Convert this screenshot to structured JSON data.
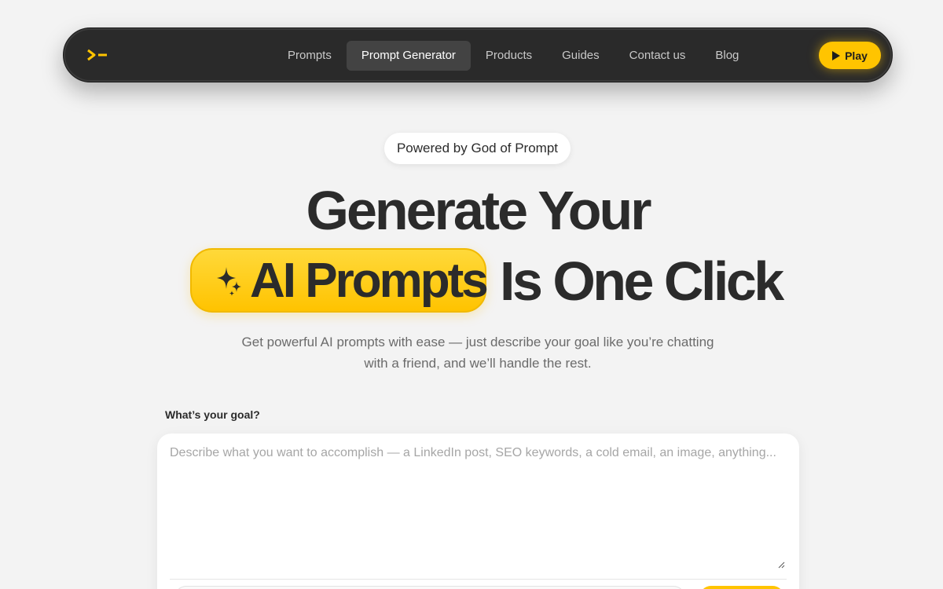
{
  "nav": {
    "links": [
      "Prompts",
      "Prompt Generator",
      "Products",
      "Guides",
      "Contact us",
      "Blog"
    ],
    "active_index": 1,
    "play_label": "Play"
  },
  "hero": {
    "badge": "Powered by God of Prompt",
    "line1": "Generate Your",
    "pill": "AI Prompts",
    "line2": "Is One Click",
    "subtitle": "Get powerful AI prompts with ease — just describe your goal like you’re chatting with a friend, and we’ll handle the rest."
  },
  "form": {
    "label": "What’s your goal?",
    "placeholder": "Describe what you want to accomplish — a LinkedIn post, SEO keywords, a cold email, an image, anything..."
  },
  "colors": {
    "accent": "#ffc400",
    "nav_bg": "#2a2a2a",
    "text": "#2b2b2b"
  },
  "icons": {
    "logo": "terminal-prompt-icon",
    "play": "play-icon",
    "sparkle": "sparkles-icon"
  }
}
